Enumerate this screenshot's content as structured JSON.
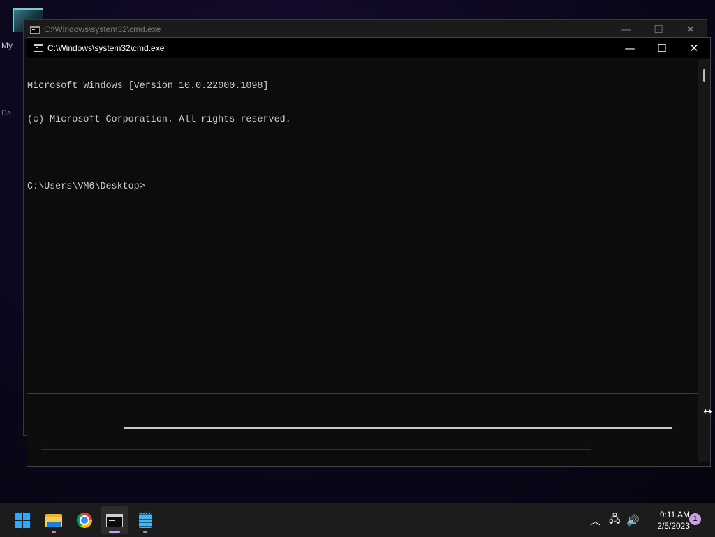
{
  "desktop": {
    "icon_label_top": "My",
    "icon_label_bottom": "Da"
  },
  "background_window": {
    "title": "C:\\Windows\\system32\\cmd.exe",
    "minimize_glyph": "—",
    "maximize_glyph": "☐",
    "close_glyph": "✕"
  },
  "active_window": {
    "title": "C:\\Windows\\system32\\cmd.exe",
    "minimize_glyph": "—",
    "maximize_glyph": "☐",
    "close_glyph": "✕",
    "console_lines": [
      "Microsoft Windows [Version 10.0.22000.1098]",
      "(c) Microsoft Corporation. All rights reserved.",
      "",
      "C:\\Users\\VM6\\Desktop>"
    ]
  },
  "cursor": {
    "glyph": "↔"
  },
  "taskbar": {
    "apps": [
      {
        "name": "Start",
        "icon": "windows-logo-icon",
        "active": false
      },
      {
        "name": "File Explorer",
        "icon": "folder-icon",
        "active": false,
        "indicator_color": "#d98ca0"
      },
      {
        "name": "Google Chrome",
        "icon": "chrome-icon",
        "active": false
      },
      {
        "name": "Command Prompt",
        "icon": "cmd-icon",
        "active": true,
        "indicator_color": "#c8a0e8"
      },
      {
        "name": "Notepad",
        "icon": "notepad-icon",
        "active": false,
        "indicator_color": "#9a9a9a"
      }
    ],
    "tray": {
      "overflow_glyph": "︿",
      "network_glyph": "🖧",
      "volume_glyph": "🔊"
    },
    "clock": {
      "time": "9:11 AM",
      "date": "2/5/2023"
    },
    "notification_count": "1"
  },
  "colors": {
    "console_text": "#cccccc",
    "console_bg": "#0c0c0c",
    "start_accent": "#3aa6f0",
    "notification_badge": "#c8a0e8"
  }
}
